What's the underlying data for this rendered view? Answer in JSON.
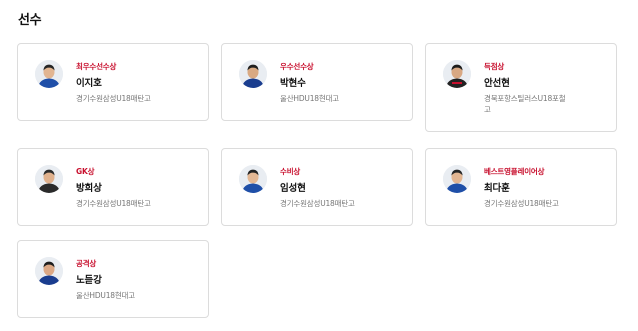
{
  "section": {
    "title": "선수"
  },
  "players": [
    {
      "award": "최우수선수상",
      "name": "이지호",
      "team": "경기수원삼성U18매탄고",
      "kit": "#1f4fa8"
    },
    {
      "award": "우수선수상",
      "name": "박현수",
      "team": "울산HDU18현대고",
      "kit": "#1a3d8f"
    },
    {
      "award": "득점상",
      "name": "안선현",
      "team": "경북포항스틸러스U18포항제철고",
      "team_lines": [
        "경북포항스틸러스U18포철",
        "고"
      ],
      "kit": "#222222"
    },
    {
      "award": "GK상",
      "name": "방희상",
      "team": "경기수원삼성U18매탄고",
      "kit": "#2a2a2a"
    },
    {
      "award": "수비상",
      "name": "임성현",
      "team": "경기수원삼성U18매탄고",
      "kit": "#1f4fa8"
    },
    {
      "award": "베스트영플레이어상",
      "name": "최다훈",
      "team": "경기수원삼성U18매탄고",
      "kit": "#1f4fa8"
    },
    {
      "award": "공격상",
      "name": "노듣강",
      "team": "울산HDU18현대고",
      "kit": "#1a3d8f"
    }
  ],
  "colors": {
    "award_accent": "#c8102e",
    "card_border": "#dcdcdc",
    "team_text": "#777777"
  }
}
